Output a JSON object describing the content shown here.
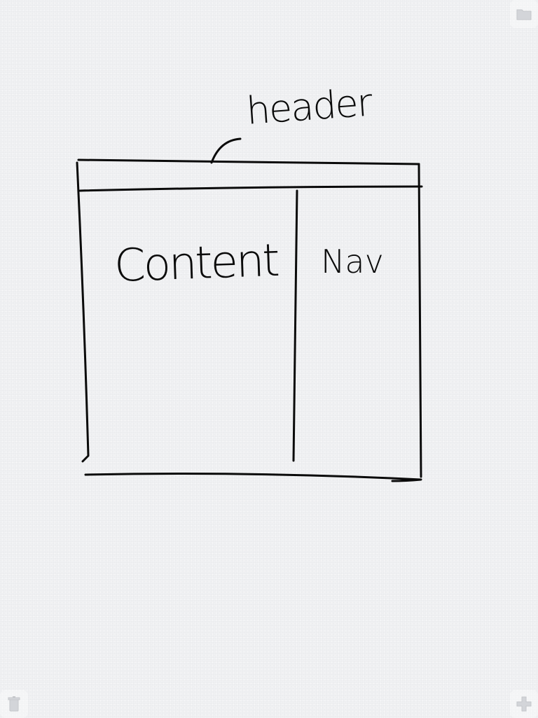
{
  "sketch": {
    "labels": {
      "header": "header",
      "content": "Content",
      "nav": "Nav"
    }
  },
  "toolbar": {
    "folder_icon": "folder-icon",
    "trash_icon": "trash-icon",
    "add_icon": "plus-icon"
  },
  "colors": {
    "paper": "#f0f1f3",
    "ink": "#0a0a0a",
    "toolbar_icon": "#c9cbcf"
  }
}
